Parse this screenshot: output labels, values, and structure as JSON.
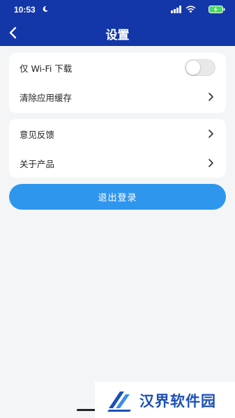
{
  "status_bar": {
    "time": "10:53"
  },
  "header": {
    "title": "设置",
    "background": "#1336a8"
  },
  "settings": {
    "group1": [
      {
        "label": "仅 Wi-Fi 下载",
        "control": "toggle",
        "toggle_on": false
      },
      {
        "label": "清除应用缓存",
        "control": "chevron"
      }
    ],
    "group2": [
      {
        "label": "意见反馈",
        "control": "chevron"
      },
      {
        "label": "关于产品",
        "control": "chevron"
      }
    ]
  },
  "logout": {
    "label": "退出登录",
    "color": "#2f96ee"
  },
  "watermark": {
    "text": "汉界软件园"
  },
  "icons": [
    "moon-icon",
    "signal-icon",
    "wifi-icon",
    "battery-icon",
    "back-arrow-icon",
    "chevron-right-icon"
  ]
}
